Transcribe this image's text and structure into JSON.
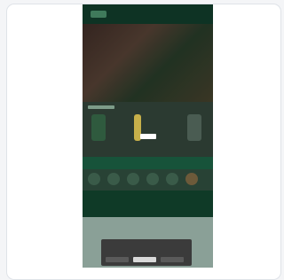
{
  "page": {
    "promo_title": "",
    "promo_subtitle": "",
    "promo_button": ""
  },
  "cookie_banner": {
    "title": "",
    "text": "",
    "buttons": [
      "",
      "",
      ""
    ]
  },
  "colors": {
    "header": "#0e3324",
    "page_green": "#1d4a35",
    "band_green": "#17533a",
    "cookie_bg": "#3b3b3b"
  }
}
